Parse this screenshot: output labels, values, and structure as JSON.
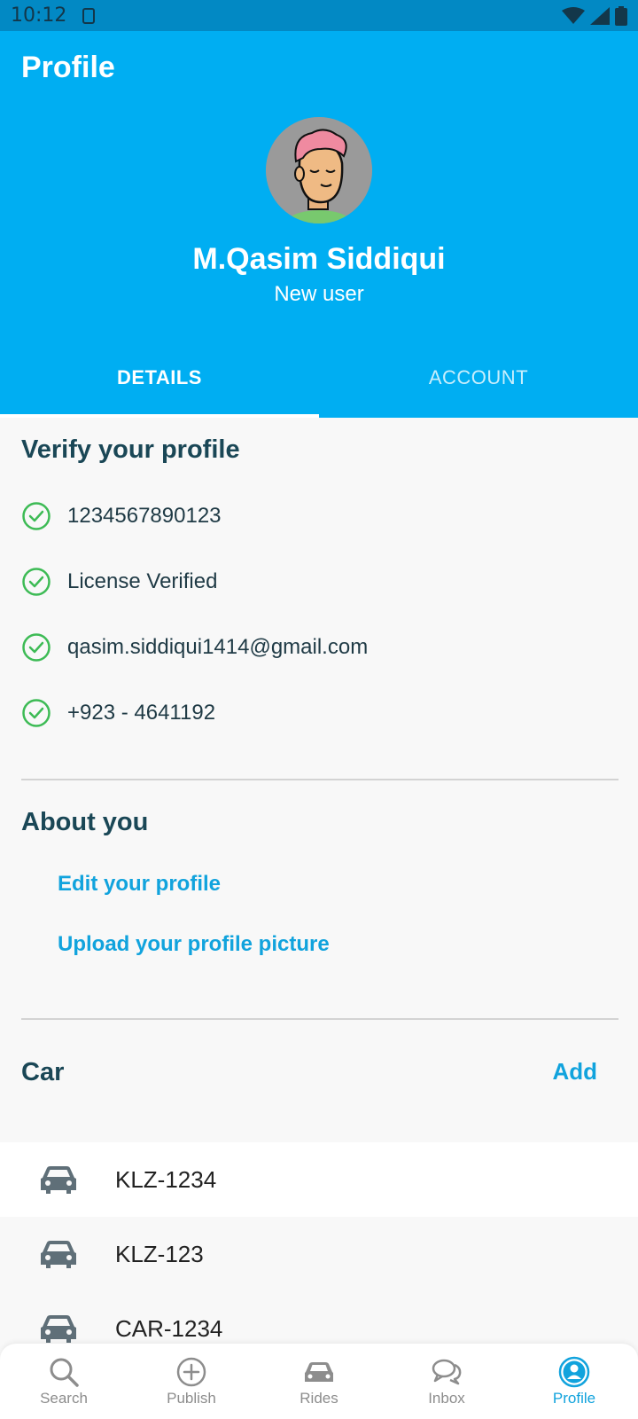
{
  "status_bar": {
    "time": "10:12"
  },
  "header": {
    "title": "Profile",
    "user_name": "M.Qasim Siddiqui",
    "user_status": "New user"
  },
  "tabs": [
    {
      "label": "DETAILS",
      "active": true
    },
    {
      "label": "ACCOUNT",
      "active": false
    }
  ],
  "verify": {
    "title": "Verify your profile",
    "items": [
      {
        "text": "1234567890123",
        "icon": "check-circle-icon"
      },
      {
        "text": "License Verified",
        "icon": "check-circle-icon"
      },
      {
        "text": "qasim.siddiqui1414@gmail.com",
        "icon": "check-circle-icon"
      },
      {
        "text": "+923 - 4641192",
        "icon": "check-circle-icon"
      }
    ]
  },
  "about": {
    "title": "About you",
    "edit_profile": "Edit your profile",
    "upload_picture": "Upload your profile picture"
  },
  "car": {
    "title": "Car",
    "add": "Add",
    "items": [
      {
        "plate": "KLZ-1234",
        "icon": "car-icon"
      },
      {
        "plate": "KLZ-123",
        "icon": "car-icon"
      },
      {
        "plate": "CAR-1234",
        "icon": "car-icon"
      }
    ]
  },
  "nav": [
    {
      "label": "Search",
      "icon": "search-icon",
      "active": false
    },
    {
      "label": "Publish",
      "icon": "plus-circle-icon",
      "active": false
    },
    {
      "label": "Rides",
      "icon": "car-icon",
      "active": false
    },
    {
      "label": "Inbox",
      "icon": "chat-bubbles-icon",
      "active": false
    },
    {
      "label": "Profile",
      "icon": "user-circle-icon",
      "active": true
    }
  ],
  "colors": {
    "header_bg": "#00aef2",
    "status_bar_bg": "#0289c4",
    "accent": "#11a3dd",
    "check_green": "#3dbb55"
  }
}
